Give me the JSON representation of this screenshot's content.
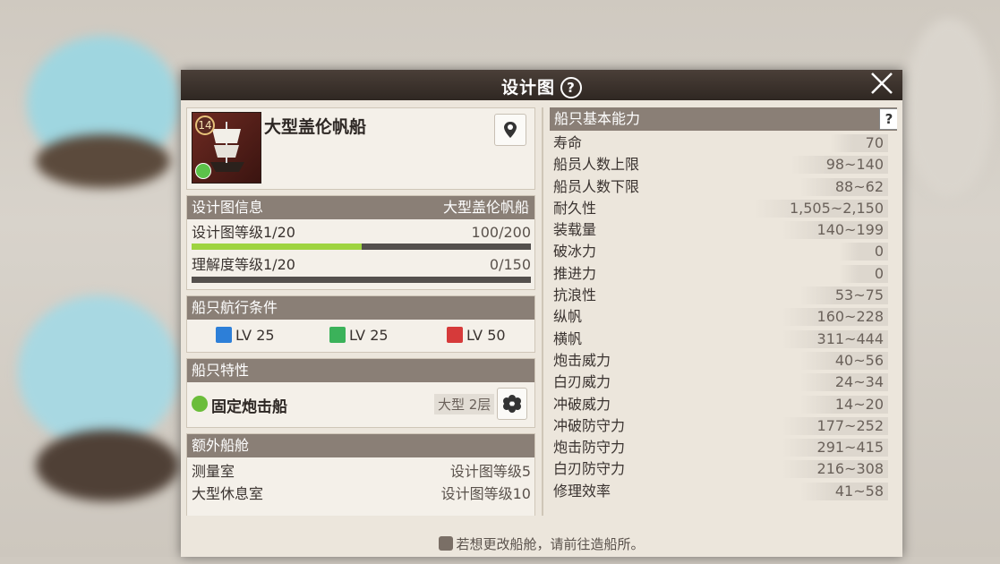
{
  "window": {
    "title": "设计图",
    "help_glyph": "?",
    "close_glyph": "✕"
  },
  "ship": {
    "name": "大型盖伦帆船",
    "badge": "14",
    "location_icon": "map-pin-icon"
  },
  "blueprint": {
    "header": "设计图信息",
    "header_value": "大型盖伦帆船",
    "level_label": "设计图等级1/20",
    "level_value": "100/200",
    "level_progress": 0.5,
    "understand_label": "理解度等级1/20",
    "understand_value": "0/150",
    "understand_progress": 0
  },
  "requirements": {
    "header": "船只航行条件",
    "items": [
      {
        "icon": "adventure-icon",
        "label": "LV 25",
        "color": "#2d7fd8"
      },
      {
        "icon": "trade-icon",
        "label": "LV 25",
        "color": "#3bb25a"
      },
      {
        "icon": "battle-icon",
        "label": "LV 50",
        "color": "#d63a3a"
      }
    ]
  },
  "traits": {
    "header": "船只特性",
    "name": "固定炮击船",
    "tag": "大型 2层"
  },
  "cabins": {
    "header": "额外船舱",
    "items": [
      {
        "name": "测量室",
        "req": "设计图等级5"
      },
      {
        "name": "大型休息室",
        "req": "设计图等级10"
      }
    ]
  },
  "stats": {
    "header": "船只基本能力",
    "help_glyph": "?",
    "items": [
      {
        "label": "寿命",
        "value": "70"
      },
      {
        "label": "船员人数上限",
        "value": "98~140"
      },
      {
        "label": "船员人数下限",
        "value": "88~62"
      },
      {
        "label": "耐久性",
        "value": "1,505~2,150"
      },
      {
        "label": "装载量",
        "value": "140~199"
      },
      {
        "label": "破冰力",
        "value": "0"
      },
      {
        "label": "推进力",
        "value": "0"
      },
      {
        "label": "抗浪性",
        "value": "53~75"
      },
      {
        "label": "纵帆",
        "value": "160~228"
      },
      {
        "label": "横帆",
        "value": "311~444"
      },
      {
        "label": "炮击威力",
        "value": "40~56"
      },
      {
        "label": "白刃威力",
        "value": "24~34"
      },
      {
        "label": "冲破威力",
        "value": "14~20"
      },
      {
        "label": "冲破防守力",
        "value": "177~252"
      },
      {
        "label": "炮击防守力",
        "value": "291~415"
      },
      {
        "label": "白刃防守力",
        "value": "216~308"
      },
      {
        "label": "修理效率",
        "value": "41~58"
      }
    ]
  },
  "footer": {
    "text": "若想更改船舱，请前往造船所。"
  }
}
